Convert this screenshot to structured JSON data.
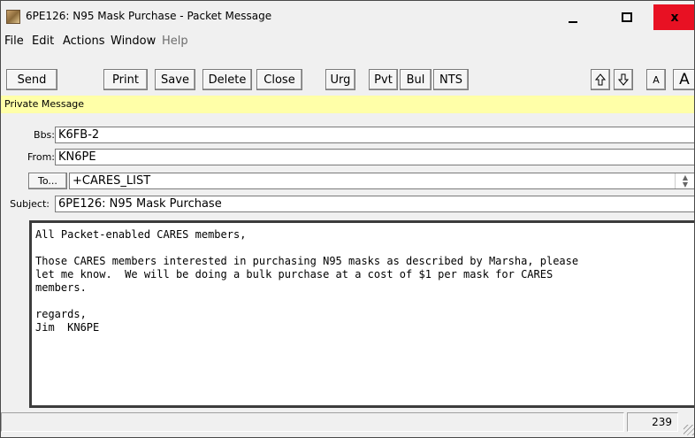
{
  "window": {
    "title": "6PE126: N95 Mask Purchase - Packet Message"
  },
  "menu": [
    "File",
    "Edit",
    "Actions",
    "Window",
    "Help"
  ],
  "toolbar": {
    "send": "Send",
    "print": "Print",
    "save": "Save",
    "delete": "Delete",
    "close": "Close",
    "urg": "Urg",
    "pvt": "Pvt",
    "bul": "Bul",
    "nts": "NTS",
    "font_small": "A",
    "font_large": "A"
  },
  "banner": "Private Message",
  "fields": {
    "bbs_label": "Bbs:",
    "bbs_value": "K6FB-2",
    "from_label": "From:",
    "from_value": "KN6PE",
    "to_button": "To...",
    "to_value": "+CARES_LIST",
    "subject_label": "Subject:",
    "subject_value": "6PE126: N95 Mask Purchase"
  },
  "message_body": "All Packet-enabled CARES members,\n\nThose CARES members interested in purchasing N95 masks as described by Marsha, please\nlet me know.  We will be doing a bulk purchase at a cost of $1 per mask for CARES\nmembers.\n\nregards,\nJim  KN6PE",
  "status": {
    "char_count": "239"
  },
  "icons": {
    "up": "arrow-up-icon",
    "down": "arrow-down-icon"
  }
}
